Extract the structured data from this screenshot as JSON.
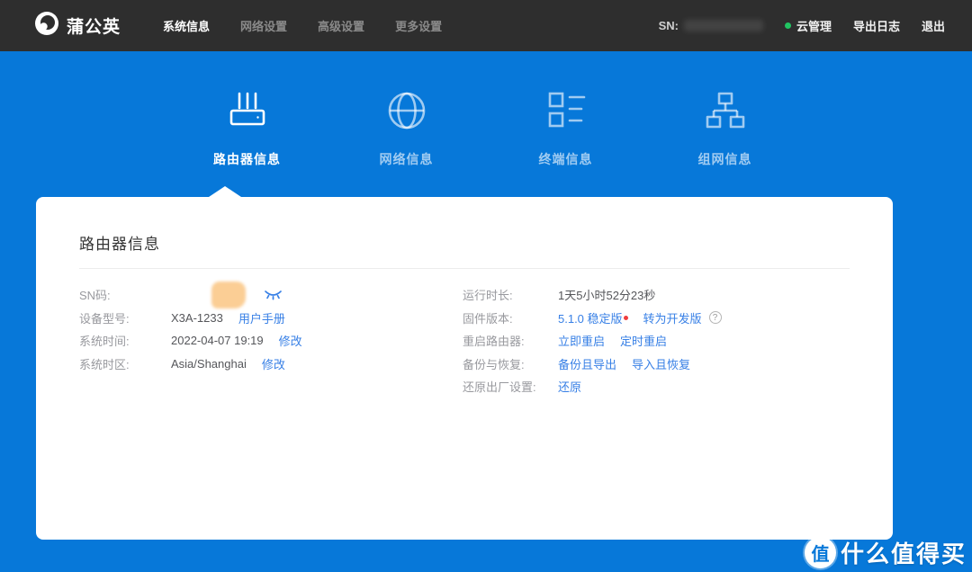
{
  "navbar": {
    "brand": "蒲公英",
    "menu": [
      {
        "label": "系统信息"
      },
      {
        "label": "网络设置"
      },
      {
        "label": "高级设置"
      },
      {
        "label": "更多设置"
      }
    ],
    "sn_label": "SN:",
    "cloud_label": "云管理",
    "export_log_label": "导出日志",
    "logout_label": "退出"
  },
  "tabs": [
    {
      "label": "路由器信息"
    },
    {
      "label": "网络信息"
    },
    {
      "label": "终端信息"
    },
    {
      "label": "组网信息"
    }
  ],
  "card": {
    "title": "路由器信息",
    "rows_left": [
      {
        "label": "SN码:"
      },
      {
        "label": "设备型号:",
        "value": "X3A-1233",
        "link": "用户手册"
      },
      {
        "label": "系统时间:",
        "value": "2022-04-07 19:19",
        "link": "修改"
      },
      {
        "label": "系统时区:",
        "value": "Asia/Shanghai",
        "link": "修改"
      }
    ],
    "rows_right": [
      {
        "label": "运行时长:",
        "value": "1天5小时52分23秒"
      },
      {
        "label": "固件版本:",
        "link1": "5.1.0 稳定版",
        "link2": "转为开发版",
        "help": "?"
      },
      {
        "label": "重启路由器:",
        "link1": "立即重启",
        "link2": "定时重启"
      },
      {
        "label": "备份与恢复:",
        "link1": "备份且导出",
        "link2": "导入且恢复"
      },
      {
        "label": "还原出厂设置:",
        "link1": "还原"
      }
    ]
  },
  "watermark": {
    "badge": "值",
    "text": "什么值得买"
  },
  "colors": {
    "accent_blue": "#0778D9",
    "link_blue": "#3880E6",
    "navbar_bg": "#2E2E2E",
    "green_dot": "#21C462",
    "red_dot": "#F03E3E"
  }
}
